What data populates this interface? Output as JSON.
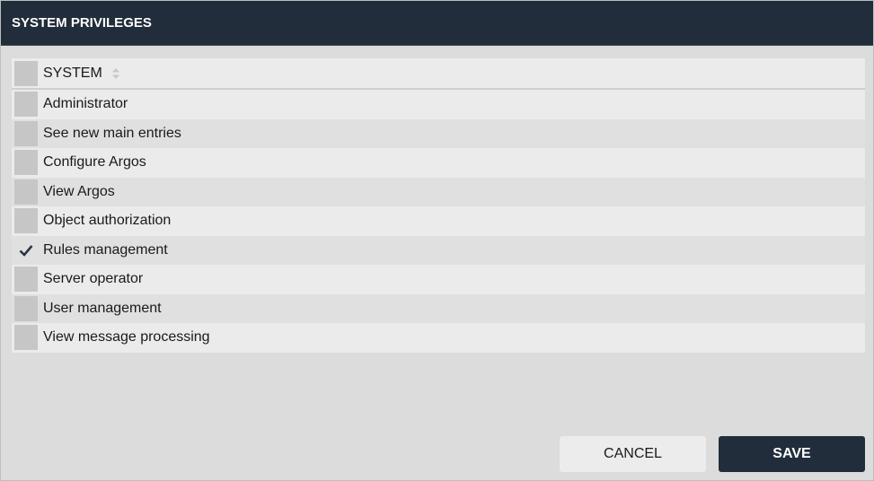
{
  "dialog": {
    "title": "SYSTEM PRIVILEGES"
  },
  "table": {
    "header": {
      "label": "SYSTEM",
      "sort_icon": "sort-icon"
    },
    "rows": [
      {
        "label": "Administrator",
        "checked": false
      },
      {
        "label": "See new main entries",
        "checked": false
      },
      {
        "label": "Configure Argos",
        "checked": false
      },
      {
        "label": "View Argos",
        "checked": false
      },
      {
        "label": "Object authorization",
        "checked": false
      },
      {
        "label": "Rules management",
        "checked": true
      },
      {
        "label": "Server operator",
        "checked": false
      },
      {
        "label": "User management",
        "checked": false
      },
      {
        "label": "View message processing",
        "checked": false
      }
    ]
  },
  "buttons": {
    "cancel_label": "CANCEL",
    "save_label": "SAVE"
  },
  "colors": {
    "header_bg": "#212d3b",
    "save_bg": "#212d3b",
    "checkmark": "#2b3544"
  }
}
